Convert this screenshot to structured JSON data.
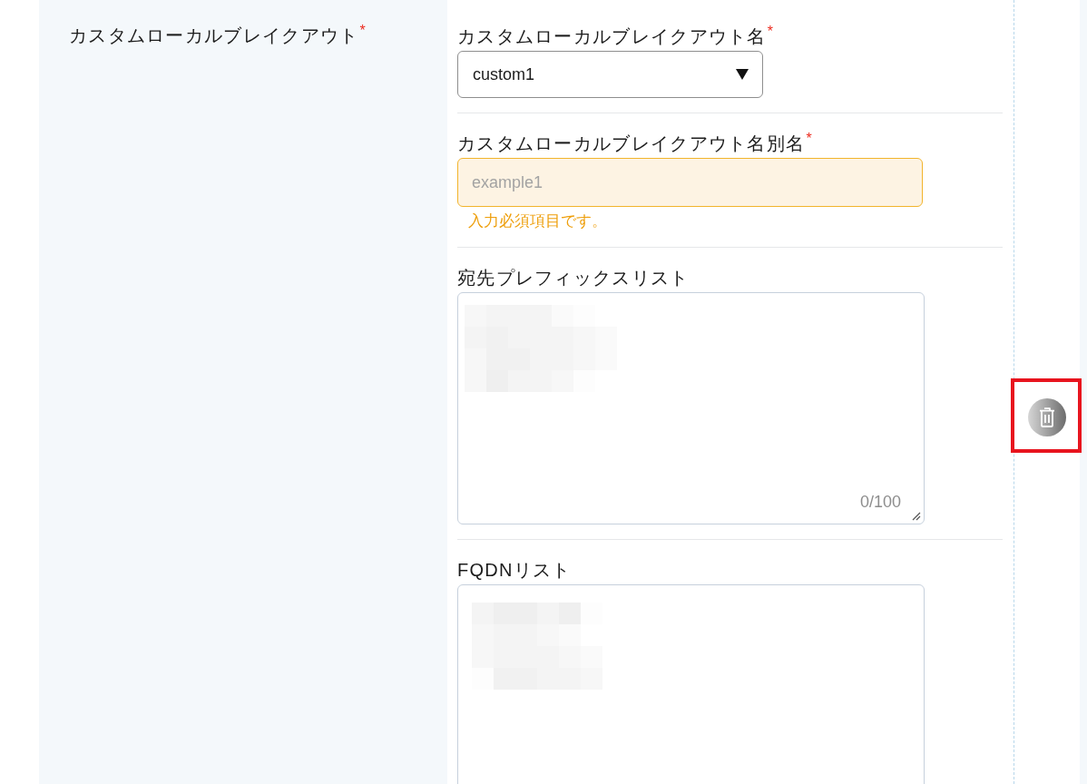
{
  "section": {
    "label": "カスタムローカルブレイクアウト",
    "required_mark": "*"
  },
  "fields": [
    {
      "kind": "select",
      "label": "カスタムローカルブレイクアウト名",
      "required_mark": "*",
      "value": "custom1"
    },
    {
      "kind": "input",
      "label": "カスタムローカルブレイクアウト名別名",
      "required_mark": "*",
      "placeholder": "example1",
      "error": "入力必須項目です。"
    },
    {
      "kind": "textarea",
      "label": "宛先プレフィックスリスト",
      "redacted": true,
      "counter": "0/100"
    },
    {
      "kind": "textarea",
      "label": "FQDNリスト",
      "redacted": true
    }
  ],
  "delete_button": {
    "highlighted": true
  }
}
